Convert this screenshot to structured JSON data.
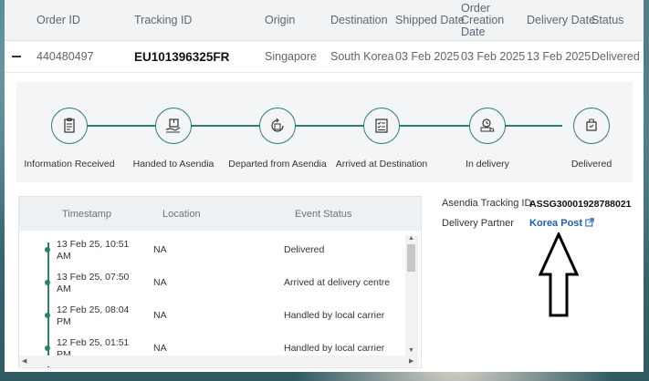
{
  "table": {
    "headers": [
      "Order ID",
      "Tracking ID",
      "Origin",
      "Destination",
      "Shipped Date",
      "Order Creation Date",
      "Delivery Date",
      "Status"
    ],
    "row": {
      "order_id": "440480497",
      "tracking_id": "EU101396325FR",
      "origin": "Singapore",
      "destination": "South Korea",
      "shipped_date": "03 Feb 2025",
      "order_creation_date": "03 Feb 2025",
      "delivery_date": "13 Feb 2025",
      "status": "Delivered"
    }
  },
  "progress": {
    "steps": [
      {
        "label": "Information Received",
        "icon": "clipboard-icon"
      },
      {
        "label": "Handed to Asendia",
        "icon": "package-hand-icon"
      },
      {
        "label": "Departed from Asendia",
        "icon": "box-arrow-icon"
      },
      {
        "label": "Arrived at Destination",
        "icon": "checklist-icon"
      },
      {
        "label": "In delivery",
        "icon": "delivery-truck-icon"
      },
      {
        "label": "Delivered",
        "icon": "delivered-box-icon"
      }
    ]
  },
  "events": {
    "headers": [
      "Timestamp",
      "Location",
      "Event Status"
    ],
    "rows": [
      {
        "timestamp": "13 Feb 25, 10:51 AM",
        "location": "NA",
        "status": "Delivered"
      },
      {
        "timestamp": "13 Feb 25, 07:50 AM",
        "location": "NA",
        "status": "Arrived at delivery centre"
      },
      {
        "timestamp": "12 Feb 25, 08:04 PM",
        "location": "NA",
        "status": "Handled by local carrier"
      },
      {
        "timestamp": "12 Feb 25, 01:51 PM",
        "location": "NA",
        "status": "Handled by local carrier"
      }
    ]
  },
  "info": {
    "tracking_label": "Asendia Tracking ID",
    "tracking_value": "ASSG30001928788021",
    "partner_label": "Delivery Partner",
    "partner_value": "Korea Post"
  },
  "colors": {
    "accent": "#2f7d6c",
    "link": "#1f5fa8"
  }
}
